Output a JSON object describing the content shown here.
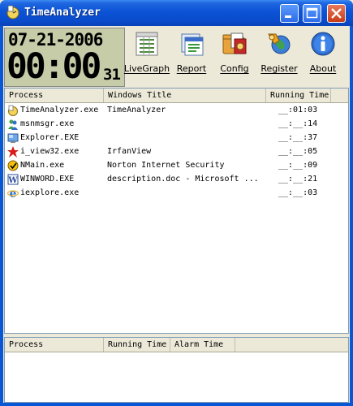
{
  "window": {
    "title": "TimeAnalyzer"
  },
  "lcd": {
    "date": "07-21-2006",
    "time": "00:00",
    "seconds": "31"
  },
  "toolbar": {
    "livegraph": "LiveGraph",
    "report": "Report",
    "config": "Config",
    "register": "Register",
    "about": "About"
  },
  "process_list": {
    "columns": [
      "Process",
      "Windows Title",
      "Running Time"
    ],
    "rows": [
      {
        "process": "TimeAnalyzer.exe",
        "title": "TimeAnalyzer",
        "time": "__:01:03",
        "icon": "timeanalyzer-icon"
      },
      {
        "process": "msnmsgr.exe",
        "title": "",
        "time": "__:__:14",
        "icon": "msn-messenger-icon"
      },
      {
        "process": "Explorer.EXE",
        "title": "",
        "time": "__:__:37",
        "icon": "explorer-icon"
      },
      {
        "process": "i_view32.exe",
        "title": "IrfanView",
        "time": "__:__:05",
        "icon": "irfanview-icon"
      },
      {
        "process": "NMain.exe",
        "title": "Norton Internet Security",
        "time": "__:__:09",
        "icon": "norton-icon"
      },
      {
        "process": "WINWORD.EXE",
        "title": "description.doc - Microsoft ...",
        "time": "__:__:21",
        "icon": "word-icon"
      },
      {
        "process": "iexplore.exe",
        "title": "",
        "time": "__:__:03",
        "icon": "internet-explorer-icon"
      }
    ]
  },
  "alarm_list": {
    "columns": [
      "Process",
      "Running Time",
      "Alarm Time"
    ]
  }
}
